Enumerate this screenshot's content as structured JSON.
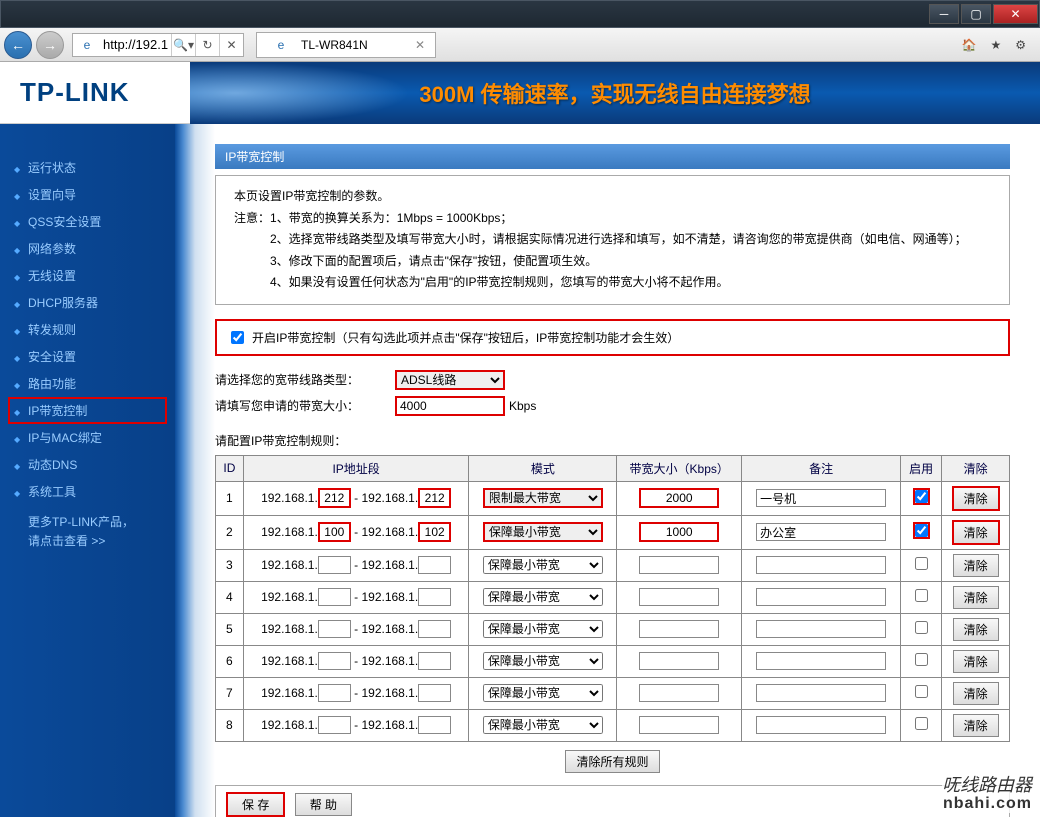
{
  "window": {
    "url": "http://192.1...",
    "tab_title": "TL-WR841N"
  },
  "banner": {
    "logo": "TP-LINK",
    "slogan": "300M 传输速率，实现无线自由连接梦想"
  },
  "sidebar": {
    "items": [
      {
        "label": "运行状态"
      },
      {
        "label": "设置向导"
      },
      {
        "label": "QSS安全设置"
      },
      {
        "label": "网络参数"
      },
      {
        "label": "无线设置"
      },
      {
        "label": "DHCP服务器"
      },
      {
        "label": "转发规则"
      },
      {
        "label": "安全设置"
      },
      {
        "label": "路由功能"
      },
      {
        "label": "IP带宽控制",
        "active": true
      },
      {
        "label": "IP与MAC绑定"
      },
      {
        "label": "动态DNS"
      },
      {
        "label": "系统工具"
      }
    ],
    "more_line1": "更多TP-LINK产品，",
    "more_line2": "请点击查看 >>"
  },
  "page": {
    "title": "IP带宽控制",
    "intro": "本页设置IP带宽控制的参数。",
    "note_label": "注意：",
    "note1": "1、带宽的换算关系为：1Mbps = 1000Kbps；",
    "note2": "2、选择宽带线路类型及填写带宽大小时，请根据实际情况进行选择和填写，如不清楚，请咨询您的带宽提供商（如电信、网通等）；",
    "note3": "3、修改下面的配置项后，请点击\"保存\"按钮，使配置项生效。",
    "note4": "4、如果没有设置任何状态为\"启用\"的IP带宽控制规则，您填写的带宽大小将不起作用。",
    "enable_label": "开启IP带宽控制（只有勾选此项并点击\"保存\"按钮后，IP带宽控制功能才会生效）",
    "enable_checked": true,
    "line_type_label": "请选择您的宽带线路类型：",
    "line_type_value": "ADSL线路",
    "bandwidth_label": "请填写您申请的带宽大小：",
    "bandwidth_value": "4000",
    "bandwidth_unit": "Kbps",
    "rules_label": "请配置IP带宽控制规则：",
    "headers": {
      "id": "ID",
      "ip": "IP地址段",
      "mode": "模式",
      "bw": "带宽大小（Kbps）",
      "remark": "备注",
      "enable": "启用",
      "clear": "清除"
    },
    "ip_prefix": "192.168.1.",
    "mode_limit": "限制最大带宽",
    "mode_guarantee": "保障最小带宽",
    "rules": [
      {
        "id": 1,
        "start": "212",
        "end": "212",
        "mode": "限制最大带宽",
        "bw": "2000",
        "remark": "一号机",
        "enabled": true,
        "hl": true
      },
      {
        "id": 2,
        "start": "100",
        "end": "102",
        "mode": "保障最小带宽",
        "bw": "1000",
        "remark": "办公室",
        "enabled": true,
        "hl": true
      },
      {
        "id": 3,
        "start": "",
        "end": "",
        "mode": "保障最小带宽",
        "bw": "",
        "remark": "",
        "enabled": false,
        "hl": false
      },
      {
        "id": 4,
        "start": "",
        "end": "",
        "mode": "保障最小带宽",
        "bw": "",
        "remark": "",
        "enabled": false,
        "hl": false
      },
      {
        "id": 5,
        "start": "",
        "end": "",
        "mode": "保障最小带宽",
        "bw": "",
        "remark": "",
        "enabled": false,
        "hl": false
      },
      {
        "id": 6,
        "start": "",
        "end": "",
        "mode": "保障最小带宽",
        "bw": "",
        "remark": "",
        "enabled": false,
        "hl": false
      },
      {
        "id": 7,
        "start": "",
        "end": "",
        "mode": "保障最小带宽",
        "bw": "",
        "remark": "",
        "enabled": false,
        "hl": false
      },
      {
        "id": 8,
        "start": "",
        "end": "",
        "mode": "保障最小带宽",
        "bw": "",
        "remark": "",
        "enabled": false,
        "hl": false
      }
    ],
    "clear_btn": "清除",
    "clear_all_btn": "清除所有规则",
    "save_btn": "保 存",
    "help_btn": "帮 助"
  },
  "watermark": {
    "line1": "呒线路由器",
    "line2": "nbahi.com"
  }
}
